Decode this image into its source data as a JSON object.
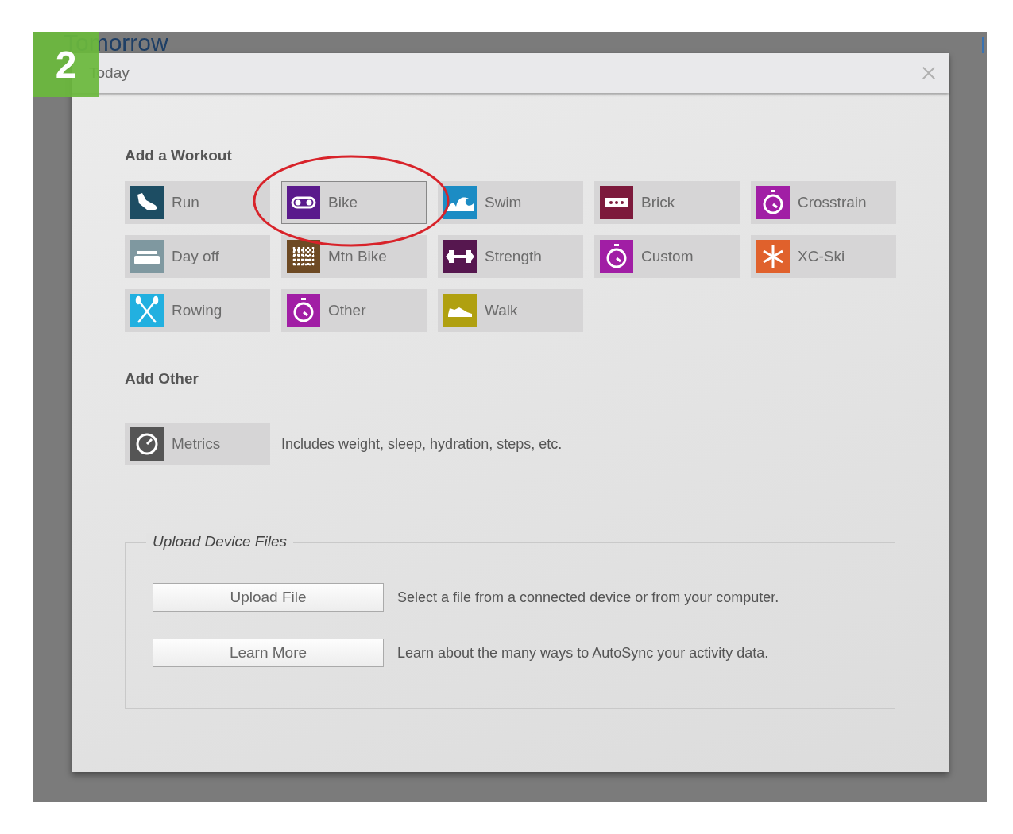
{
  "step_badge": "2",
  "background": {
    "heading": "Tomorrow"
  },
  "dialog": {
    "title": "Today",
    "workout_section": {
      "heading": "Add a Workout",
      "tiles": [
        {
          "label": "Run",
          "kind": "shoe",
          "color": "#1d4d63",
          "selected": false,
          "circled": false
        },
        {
          "label": "Bike",
          "kind": "chain",
          "color": "#5a1a8c",
          "selected": true,
          "circled": true
        },
        {
          "label": "Swim",
          "kind": "wave",
          "color": "#1c8cc4",
          "selected": false,
          "circled": false
        },
        {
          "label": "Brick",
          "kind": "dots",
          "color": "#7d1a3c",
          "selected": false,
          "circled": false
        },
        {
          "label": "Crosstrain",
          "kind": "stopwatch",
          "color": "#a11ea5",
          "selected": false,
          "circled": false
        },
        {
          "label": "Day off",
          "kind": "bed",
          "color": "#7f98a0",
          "selected": false,
          "circled": false
        },
        {
          "label": "Mtn Bike",
          "kind": "grid",
          "color": "#6e4a24",
          "selected": false,
          "circled": false
        },
        {
          "label": "Strength",
          "kind": "dumbbell",
          "color": "#56174f",
          "selected": false,
          "circled": false
        },
        {
          "label": "Custom",
          "kind": "stopwatch",
          "color": "#a11ea5",
          "selected": false,
          "circled": false
        },
        {
          "label": "XC-Ski",
          "kind": "snowflake",
          "color": "#e0612c",
          "selected": false,
          "circled": false
        },
        {
          "label": "Rowing",
          "kind": "oars",
          "color": "#22b0e0",
          "selected": false,
          "circled": false
        },
        {
          "label": "Other",
          "kind": "stopwatch",
          "color": "#a11ea5",
          "selected": false,
          "circled": false
        },
        {
          "label": "Walk",
          "kind": "sneaker",
          "color": "#b0a010",
          "selected": false,
          "circled": false
        }
      ]
    },
    "other_section": {
      "heading": "Add Other",
      "tile": {
        "label": "Metrics",
        "kind": "gauge",
        "color": "#555555"
      },
      "description": "Includes weight, sleep, hydration, steps, etc."
    },
    "upload_section": {
      "legend": "Upload Device Files",
      "actions": [
        {
          "button": "Upload File",
          "description": "Select a file from a connected device or from your computer."
        },
        {
          "button": "Learn More",
          "description": "Learn about the many ways to AutoSync your activity data."
        }
      ]
    }
  }
}
